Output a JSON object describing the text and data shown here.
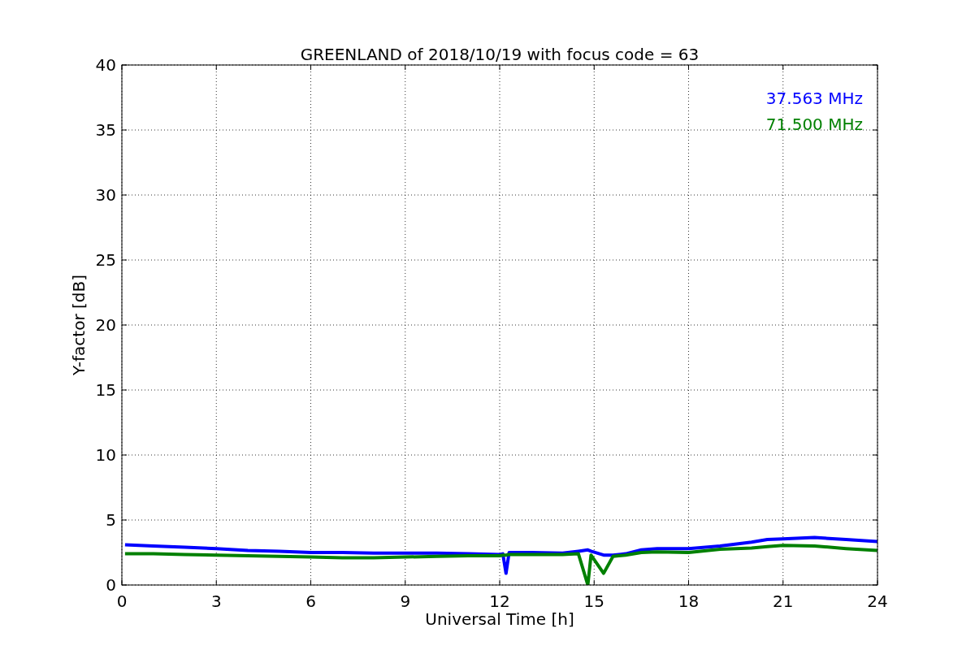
{
  "chart_data": {
    "type": "line",
    "title": "GREENLAND of 2018/10/19 with focus code = 63",
    "xlabel": "Universal Time [h]",
    "ylabel": "Y-factor [dB]",
    "x": [
      0.1,
      1,
      2,
      3,
      4,
      5,
      6,
      7,
      8,
      9,
      10,
      11,
      12,
      12.1,
      12.2,
      12.3,
      13,
      14,
      14.5,
      14.8,
      14.9,
      15.3,
      15.6,
      16,
      16.5,
      17,
      18,
      19,
      20,
      20.5,
      21,
      22,
      23,
      24
    ],
    "series": [
      {
        "name": "37.563 MHz",
        "color": "#0000ff",
        "values": [
          3.1,
          3.0,
          2.9,
          2.8,
          2.65,
          2.6,
          2.5,
          2.5,
          2.45,
          2.45,
          2.45,
          2.4,
          2.35,
          2.4,
          0.9,
          2.5,
          2.5,
          2.45,
          2.6,
          2.7,
          2.6,
          2.3,
          2.3,
          2.4,
          2.7,
          2.8,
          2.8,
          3.0,
          3.3,
          3.5,
          3.55,
          3.65,
          3.5,
          3.35
        ]
      },
      {
        "name": "71.500 MHz",
        "color": "#008000",
        "values": [
          2.4,
          2.4,
          2.35,
          2.3,
          2.25,
          2.2,
          2.15,
          2.1,
          2.1,
          2.15,
          2.2,
          2.25,
          2.25,
          2.3,
          2.3,
          2.35,
          2.35,
          2.35,
          2.4,
          0,
          2.3,
          0.9,
          2.2,
          2.3,
          2.5,
          2.55,
          2.5,
          2.75,
          2.85,
          2.95,
          3.05,
          3.0,
          2.8,
          2.65
        ]
      }
    ],
    "xlim": [
      0,
      24
    ],
    "ylim": [
      0,
      40
    ],
    "xticks": [
      0,
      3,
      6,
      9,
      12,
      15,
      18,
      21,
      24
    ],
    "yticks": [
      0,
      5,
      10,
      15,
      20,
      25,
      30,
      35,
      40
    ],
    "grid": true
  }
}
